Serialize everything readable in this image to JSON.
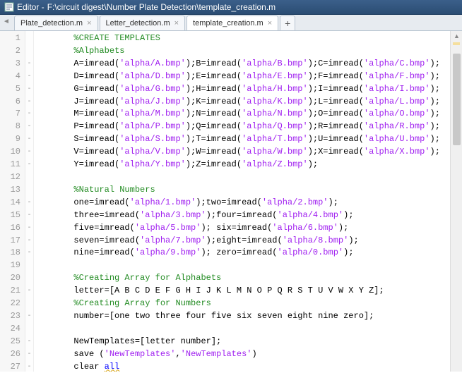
{
  "titlebar": {
    "prefix": "Editor - ",
    "path": "F:\\circuit digest\\Number Plate Detection\\template_creation.m"
  },
  "tabs": [
    {
      "label": "Plate_detection.m",
      "active": false
    },
    {
      "label": "Letter_detection.m",
      "active": false
    },
    {
      "label": "template_creation.m",
      "active": true
    }
  ],
  "lines": [
    {
      "n": 1,
      "fold": "",
      "segs": [
        [
          "ind",
          ""
        ],
        [
          "com",
          "%CREATE TEMPLATES"
        ]
      ]
    },
    {
      "n": 2,
      "fold": "",
      "segs": [
        [
          "ind",
          ""
        ],
        [
          "com",
          "%Alphabets"
        ]
      ]
    },
    {
      "n": 3,
      "fold": "-",
      "segs": [
        [
          "ind",
          ""
        ],
        [
          "txt",
          "A=imread("
        ],
        [
          "str",
          "'alpha/A.bmp'"
        ],
        [
          "txt",
          ");B=imread("
        ],
        [
          "str",
          "'alpha/B.bmp'"
        ],
        [
          "txt",
          ");C=imread("
        ],
        [
          "str",
          "'alpha/C.bmp'"
        ],
        [
          "txt",
          ");"
        ]
      ]
    },
    {
      "n": 4,
      "fold": "-",
      "segs": [
        [
          "ind",
          ""
        ],
        [
          "txt",
          "D=imread("
        ],
        [
          "str",
          "'alpha/D.bmp'"
        ],
        [
          "txt",
          ");E=imread("
        ],
        [
          "str",
          "'alpha/E.bmp'"
        ],
        [
          "txt",
          ");F=imread("
        ],
        [
          "str",
          "'alpha/F.bmp'"
        ],
        [
          "txt",
          ");"
        ]
      ]
    },
    {
      "n": 5,
      "fold": "-",
      "segs": [
        [
          "ind",
          ""
        ],
        [
          "txt",
          "G=imread("
        ],
        [
          "str",
          "'alpha/G.bmp'"
        ],
        [
          "txt",
          ");H=imread("
        ],
        [
          "str",
          "'alpha/H.bmp'"
        ],
        [
          "txt",
          ");I=imread("
        ],
        [
          "str",
          "'alpha/I.bmp'"
        ],
        [
          "txt",
          ");"
        ]
      ]
    },
    {
      "n": 6,
      "fold": "-",
      "segs": [
        [
          "ind",
          ""
        ],
        [
          "txt",
          "J=imread("
        ],
        [
          "str",
          "'alpha/J.bmp'"
        ],
        [
          "txt",
          ");K=imread("
        ],
        [
          "str",
          "'alpha/K.bmp'"
        ],
        [
          "txt",
          ");L=imread("
        ],
        [
          "str",
          "'alpha/L.bmp'"
        ],
        [
          "txt",
          ");"
        ]
      ]
    },
    {
      "n": 7,
      "fold": "-",
      "segs": [
        [
          "ind",
          ""
        ],
        [
          "txt",
          "M=imread("
        ],
        [
          "str",
          "'alpha/M.bmp'"
        ],
        [
          "txt",
          ");N=imread("
        ],
        [
          "str",
          "'alpha/N.bmp'"
        ],
        [
          "txt",
          ");O=imread("
        ],
        [
          "str",
          "'alpha/O.bmp'"
        ],
        [
          "txt",
          ");"
        ]
      ]
    },
    {
      "n": 8,
      "fold": "-",
      "segs": [
        [
          "ind",
          ""
        ],
        [
          "txt",
          "P=imread("
        ],
        [
          "str",
          "'alpha/P.bmp'"
        ],
        [
          "txt",
          ");Q=imread("
        ],
        [
          "str",
          "'alpha/Q.bmp'"
        ],
        [
          "txt",
          ");R=imread("
        ],
        [
          "str",
          "'alpha/R.bmp'"
        ],
        [
          "txt",
          ");"
        ]
      ]
    },
    {
      "n": 9,
      "fold": "-",
      "segs": [
        [
          "ind",
          ""
        ],
        [
          "txt",
          "S=imread("
        ],
        [
          "str",
          "'alpha/S.bmp'"
        ],
        [
          "txt",
          ");T=imread("
        ],
        [
          "str",
          "'alpha/T.bmp'"
        ],
        [
          "txt",
          ");U=imread("
        ],
        [
          "str",
          "'alpha/U.bmp'"
        ],
        [
          "txt",
          ");"
        ]
      ]
    },
    {
      "n": 10,
      "fold": "-",
      "segs": [
        [
          "ind",
          ""
        ],
        [
          "txt",
          "V=imread("
        ],
        [
          "str",
          "'alpha/V.bmp'"
        ],
        [
          "txt",
          ");W=imread("
        ],
        [
          "str",
          "'alpha/W.bmp'"
        ],
        [
          "txt",
          ");X=imread("
        ],
        [
          "str",
          "'alpha/X.bmp'"
        ],
        [
          "txt",
          ");"
        ]
      ]
    },
    {
      "n": 11,
      "fold": "-",
      "segs": [
        [
          "ind",
          ""
        ],
        [
          "txt",
          "Y=imread("
        ],
        [
          "str",
          "'alpha/Y.bmp'"
        ],
        [
          "txt",
          ");Z=imread("
        ],
        [
          "str",
          "'alpha/Z.bmp'"
        ],
        [
          "txt",
          ");"
        ]
      ]
    },
    {
      "n": 12,
      "fold": "",
      "segs": []
    },
    {
      "n": 13,
      "fold": "",
      "segs": [
        [
          "ind",
          ""
        ],
        [
          "com",
          "%Natural Numbers"
        ]
      ]
    },
    {
      "n": 14,
      "fold": "-",
      "segs": [
        [
          "ind",
          ""
        ],
        [
          "txt",
          "one=imread("
        ],
        [
          "str",
          "'alpha/1.bmp'"
        ],
        [
          "txt",
          ");two=imread("
        ],
        [
          "str",
          "'alpha/2.bmp'"
        ],
        [
          "txt",
          ");"
        ]
      ]
    },
    {
      "n": 15,
      "fold": "-",
      "segs": [
        [
          "ind",
          ""
        ],
        [
          "txt",
          "three=imread("
        ],
        [
          "str",
          "'alpha/3.bmp'"
        ],
        [
          "txt",
          ");four=imread("
        ],
        [
          "str",
          "'alpha/4.bmp'"
        ],
        [
          "txt",
          ");"
        ]
      ]
    },
    {
      "n": 16,
      "fold": "-",
      "segs": [
        [
          "ind",
          ""
        ],
        [
          "txt",
          "five=imread("
        ],
        [
          "str",
          "'alpha/5.bmp'"
        ],
        [
          "txt",
          "); six=imread("
        ],
        [
          "str",
          "'alpha/6.bmp'"
        ],
        [
          "txt",
          ");"
        ]
      ]
    },
    {
      "n": 17,
      "fold": "-",
      "segs": [
        [
          "ind",
          ""
        ],
        [
          "txt",
          "seven=imread("
        ],
        [
          "str",
          "'alpha/7.bmp'"
        ],
        [
          "txt",
          ");eight=imread("
        ],
        [
          "str",
          "'alpha/8.bmp'"
        ],
        [
          "txt",
          ");"
        ]
      ]
    },
    {
      "n": 18,
      "fold": "-",
      "segs": [
        [
          "ind",
          ""
        ],
        [
          "txt",
          "nine=imread("
        ],
        [
          "str",
          "'alpha/9.bmp'"
        ],
        [
          "txt",
          "); zero=imread("
        ],
        [
          "str",
          "'alpha/0.bmp'"
        ],
        [
          "txt",
          ");"
        ]
      ]
    },
    {
      "n": 19,
      "fold": "",
      "segs": []
    },
    {
      "n": 20,
      "fold": "",
      "segs": [
        [
          "ind",
          ""
        ],
        [
          "com",
          "%Creating Array for Alphabets"
        ]
      ]
    },
    {
      "n": 21,
      "fold": "-",
      "segs": [
        [
          "ind",
          ""
        ],
        [
          "txt",
          "letter=[A B C D E F G H I J K L M N O P Q R S T U V W X Y Z];"
        ]
      ]
    },
    {
      "n": 22,
      "fold": "",
      "segs": [
        [
          "ind",
          ""
        ],
        [
          "com",
          "%Creating Array for Numbers"
        ]
      ]
    },
    {
      "n": 23,
      "fold": "-",
      "segs": [
        [
          "ind",
          ""
        ],
        [
          "txt",
          "number=[one two three four five six seven eight nine zero];"
        ]
      ]
    },
    {
      "n": 24,
      "fold": "",
      "segs": []
    },
    {
      "n": 25,
      "fold": "-",
      "segs": [
        [
          "ind",
          ""
        ],
        [
          "txt",
          "NewTemplates=[letter number];"
        ]
      ]
    },
    {
      "n": 26,
      "fold": "-",
      "segs": [
        [
          "ind",
          ""
        ],
        [
          "txt",
          "save ("
        ],
        [
          "str",
          "'NewTemplates'"
        ],
        [
          "txt",
          ","
        ],
        [
          "str",
          "'NewTemplates'"
        ],
        [
          "txt",
          ")"
        ]
      ]
    },
    {
      "n": 27,
      "fold": "-",
      "segs": [
        [
          "ind",
          ""
        ],
        [
          "txt",
          "clear "
        ],
        [
          "kw",
          "all"
        ]
      ]
    }
  ]
}
